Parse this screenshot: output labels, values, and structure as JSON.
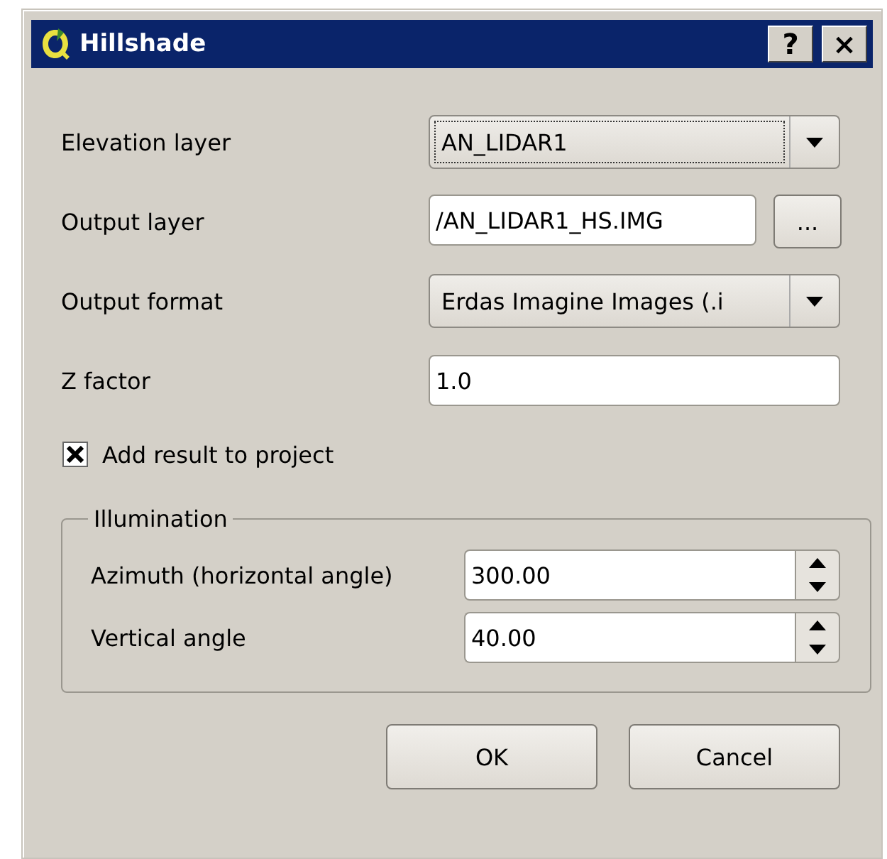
{
  "window": {
    "title": "Hillshade",
    "help_button": "?",
    "close_button": "×"
  },
  "fields": [
    {
      "kind": "combo",
      "label": "Elevation layer",
      "value": "AN_LIDAR1",
      "focused": true
    },
    {
      "kind": "file",
      "label": "Output layer",
      "value": "/AN_LIDAR1_HS.IMG",
      "browse": "..."
    },
    {
      "kind": "combo",
      "label": "Output format",
      "value": "Erdas Imagine Images (.i",
      "focused": false
    },
    {
      "kind": "text",
      "label": "Z factor",
      "value": "1.0"
    }
  ],
  "add_to_project": {
    "label": "Add result to project",
    "checked": true
  },
  "illumination": {
    "title": "Illumination",
    "fields": [
      {
        "label": "Azimuth (horizontal angle)",
        "value": "300.00"
      },
      {
        "label": "Vertical angle",
        "value": "40.00"
      }
    ]
  },
  "buttons": [
    "OK",
    "Cancel"
  ]
}
